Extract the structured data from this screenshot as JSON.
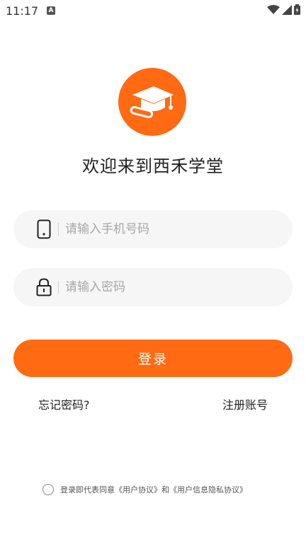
{
  "status_bar": {
    "time": "11:17",
    "notification_letter": "A"
  },
  "app": {
    "title": "欢迎来到西禾学堂"
  },
  "form": {
    "phone_placeholder": "请输入手机号码",
    "password_placeholder": "请输入密码",
    "login_label": "登录"
  },
  "links": {
    "forgot_password": "忘记密码?",
    "register": "注册账号"
  },
  "agreement": {
    "prefix": "登录即代表同意",
    "user_agreement": "《用户协议》",
    "and": "和",
    "privacy": "《用户信息隐私协议》"
  },
  "colors": {
    "brand": "#ff6a13",
    "field_bg": "#f6f6f6"
  }
}
